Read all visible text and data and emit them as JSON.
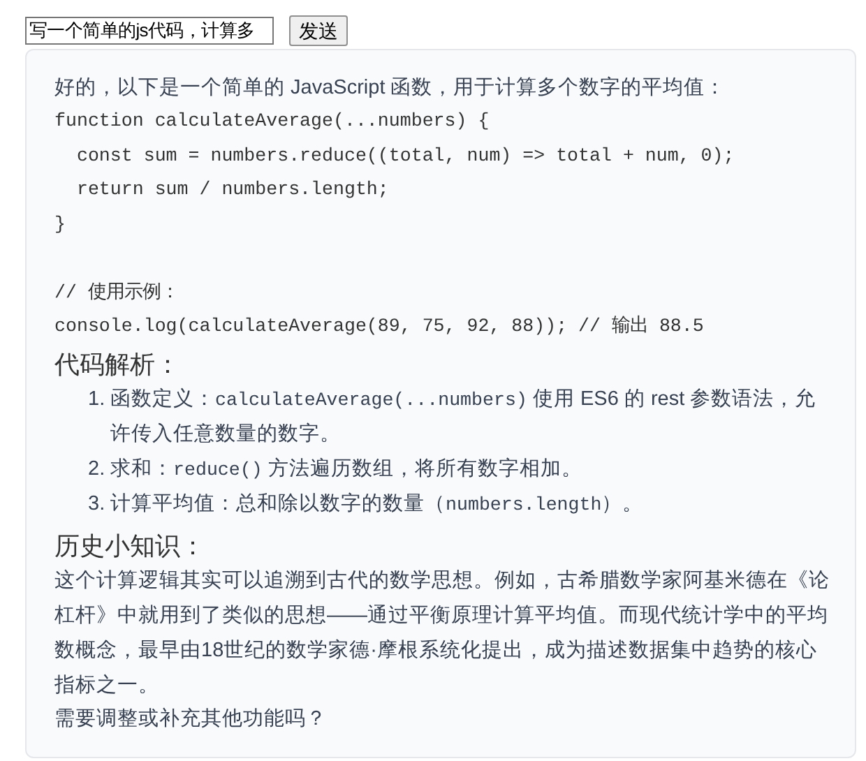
{
  "input": {
    "value": "写一个简单的js代码，计算多"
  },
  "send_button": "发送",
  "reply": {
    "intro": "好的，以下是一个简单的 JavaScript 函数，用于计算多个数字的平均值：",
    "code": "function calculateAverage(...numbers) {\n  const sum = numbers.reduce((total, num) => total + num, 0);\n  return sum / numbers.length;\n}\n\n// 使用示例：\nconsole.log(calculateAverage(89, 75, 92, 88)); // 输出 88.5",
    "heading_1": "代码解析：",
    "list": [
      {
        "number": "1.",
        "parts": [
          {
            "kind": "text",
            "text": "函数定义："
          },
          {
            "kind": "code",
            "text": "calculateAverage(...numbers)"
          },
          {
            "kind": "text",
            "text": " 使用 ES6 的 rest 参数语法，允许传入任意数量的数字。"
          }
        ]
      },
      {
        "number": "2.",
        "parts": [
          {
            "kind": "text",
            "text": "求和："
          },
          {
            "kind": "code",
            "text": "reduce()"
          },
          {
            "kind": "text",
            "text": " 方法遍历数组，将所有数字相加。"
          }
        ]
      },
      {
        "number": "3.",
        "parts": [
          {
            "kind": "text",
            "text": "计算平均值：总和除以数字的数量（"
          },
          {
            "kind": "code",
            "text": "numbers.length"
          },
          {
            "kind": "text",
            "text": "）。"
          }
        ]
      }
    ],
    "heading_2": "历史小知识：",
    "paragraph": "这个计算逻辑其实可以追溯到古代的数学思想。例如，古希腊数学家阿基米德在《论杠杆》中就用到了类似的思想——通过平衡原理计算平均值。而现代统计学中的平均数概念，最早由18世纪的数学家德·摩根系统化提出，成为描述数据集中趋势的核心指标之一。",
    "closing": "需要调整或补充其他功能吗？"
  }
}
